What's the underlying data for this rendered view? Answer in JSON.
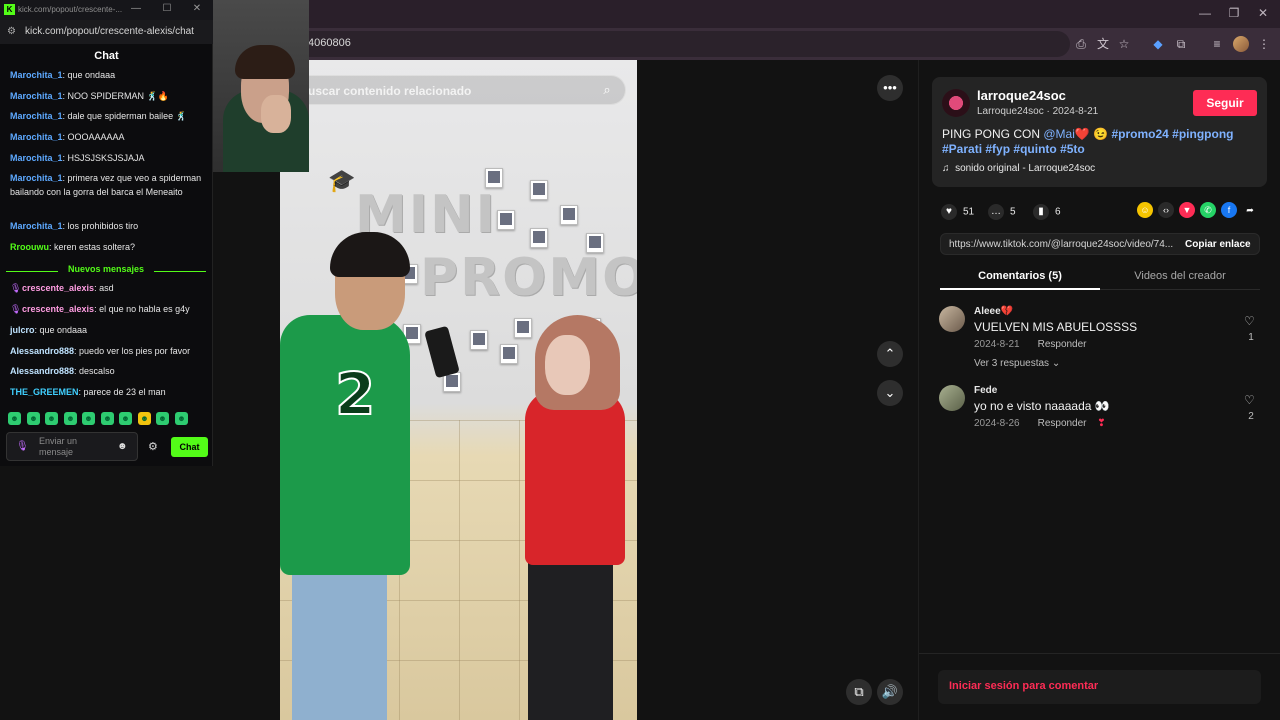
{
  "browser": {
    "url_fragment": "4060806",
    "colors": {
      "accent": "#fe2c55",
      "link": "#7fb2ff",
      "kick_green": "#53fc18"
    }
  },
  "tiktok": {
    "search_placeholder": "uscar contenido relacionado",
    "author": {
      "username": "larroque24soc",
      "display": "Larroque24soc · 2024-8-21"
    },
    "follow_label": "Seguir",
    "caption": {
      "prefix": "PING PONG CON ",
      "mention": "@Mai",
      "emoji1": "❤️",
      "emoji2": "😉",
      "hashtags": [
        "#promo24",
        "#pingpong",
        "#Parati",
        "#fyp",
        "#quinto",
        "#5to"
      ]
    },
    "sound": "sonido original - Larroque24soc",
    "stats": {
      "likes": "51",
      "comments": "5",
      "saves": "6"
    },
    "link": "https://www.tiktok.com/@larroque24soc/video/74...",
    "copy_label": "Copiar enlace",
    "tabs": {
      "comments": "Comentarios (5)",
      "videos": "Videos del creador"
    },
    "comments": [
      {
        "user": "Aleee💔",
        "text": "VUELVEN MIS ABUELOSSSS",
        "date": "2024-8-21",
        "reply": "Responder",
        "more": "Ver 3 respuestas ⌄",
        "likes": "1"
      },
      {
        "user": "Fede",
        "text": "yo no e visto naaaada 👀",
        "date": "2024-8-26",
        "reply": "Responder",
        "more": "",
        "likes": "2"
      }
    ],
    "login_prompt": "Iniciar sesión para comentar",
    "video_overlay": {
      "mini": "MINI",
      "promo": "PROMO",
      "jersey_number": "2"
    }
  },
  "chat": {
    "window_title": "kick.com/popout/crescente-...",
    "url": "kick.com/popout/crescente-alexis/chat",
    "header": "Chat",
    "messages": [
      {
        "user": "Marochita_1",
        "text": ": que ondaaa"
      },
      {
        "user": "Marochita_1",
        "text": ": NOO SPIDERMAN 🕺🔥"
      },
      {
        "user": "Marochita_1",
        "text": ": dale que spiderman bailee 🕺"
      },
      {
        "user": "Marochita_1",
        "text": ": OOOAAAAAA"
      },
      {
        "user": "Marochita_1",
        "text": ": HSJSJSKSJSJAJA"
      },
      {
        "user": "Marochita_1",
        "text": ": primera vez que veo a spiderman bailando con la gorra del barca el Meneaito"
      },
      {
        "user": "Marochita_1",
        "text": ": los prohibidos tiro"
      },
      {
        "user": "Rroouwu",
        "text": ": keren estas soltera?"
      },
      {
        "user": "crescente_alexis",
        "text": ": asd"
      },
      {
        "user": "crescente_alexis",
        "text": ": el que no habla es g4y"
      },
      {
        "user": "julcro",
        "text": ": que ondaaa"
      },
      {
        "user": "Alessandro888",
        "text": ": puedo ver los pies por favor"
      },
      {
        "user": "Alessandro888",
        "text": ": descalso"
      },
      {
        "user": "THE_GREEMEN",
        "text": ": parece de 23 el man"
      }
    ],
    "new_messages_label": "Nuevos mensajes",
    "input_placeholder": "Enviar un mensaje",
    "send_label": "Chat"
  }
}
